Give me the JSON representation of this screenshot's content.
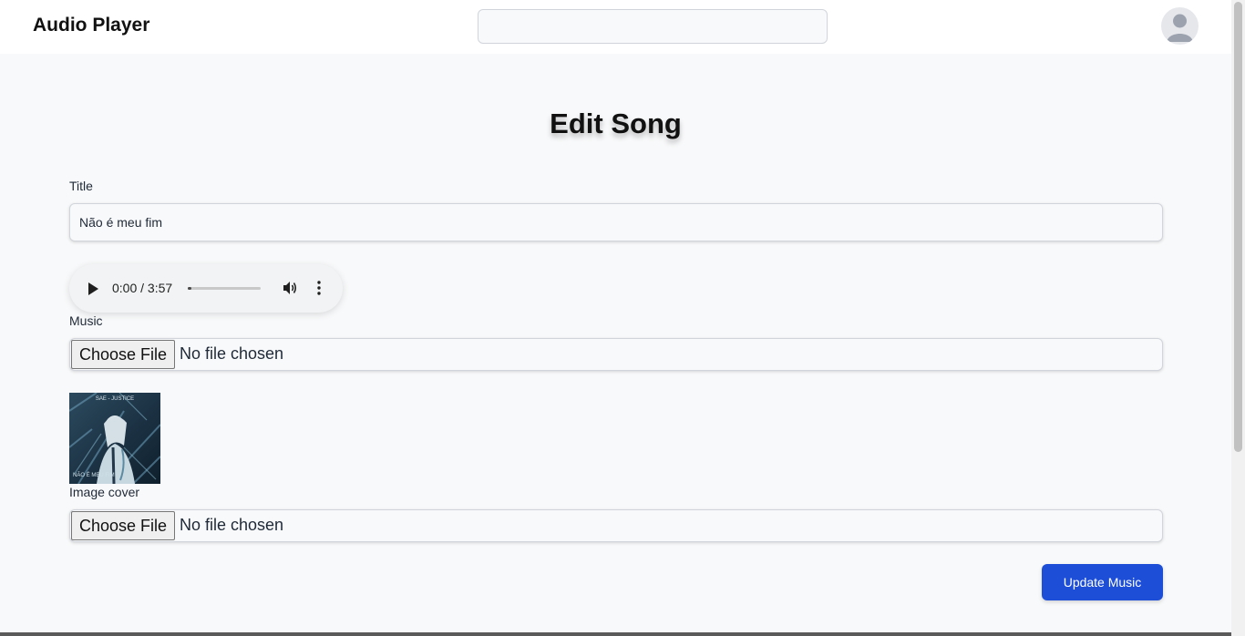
{
  "header": {
    "app_title": "Audio Player",
    "search_placeholder": "",
    "avatar_icon": "user-avatar-icon"
  },
  "page": {
    "heading": "Edit Song"
  },
  "form": {
    "title_label": "Title",
    "title_value": "Não é meu fim",
    "audio_player": {
      "time_display": "0:00 / 3:57",
      "progress": 0.05,
      "icons": [
        "play-icon",
        "volume-icon",
        "more-options-icon"
      ]
    },
    "music_label": "Music",
    "music_file": {
      "button_label": "Choose File",
      "status": "No file chosen"
    },
    "cover_image": {
      "caption": "NÃO É MEU FIM",
      "top_text": "SAE - JUSTICE"
    },
    "image_cover_label": "Image cover",
    "cover_file": {
      "button_label": "Choose File",
      "status": "No file chosen"
    },
    "submit_label": "Update Music"
  },
  "colors": {
    "primary": "#1d4ed8",
    "background": "#f8f9fa",
    "header_bg": "#ffffff"
  }
}
